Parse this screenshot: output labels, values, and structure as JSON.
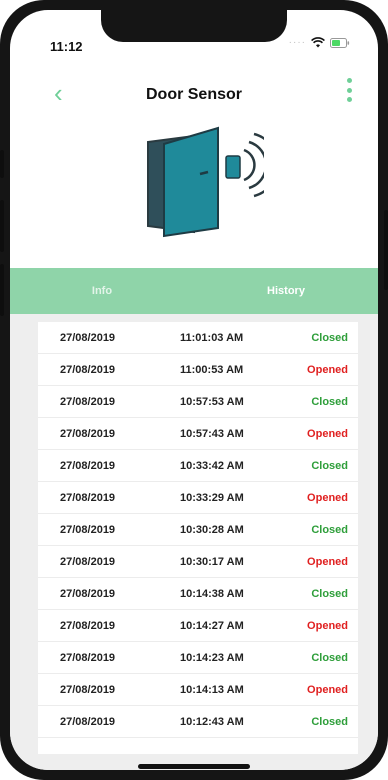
{
  "status_bar": {
    "time": "11:12"
  },
  "header": {
    "title": "Door Sensor"
  },
  "tabs": [
    {
      "label": "Info",
      "active": false
    },
    {
      "label": "History",
      "active": true
    }
  ],
  "colors": {
    "accent": "#6fcf98",
    "tab_bar": "#8fd4a9",
    "closed": "#2e9e3a",
    "opened": "#e02020"
  },
  "history": [
    {
      "date": "27/08/2019",
      "time": "11:01:03 AM",
      "status": "Closed"
    },
    {
      "date": "27/08/2019",
      "time": "11:00:53 AM",
      "status": "Opened"
    },
    {
      "date": "27/08/2019",
      "time": "10:57:53 AM",
      "status": "Closed"
    },
    {
      "date": "27/08/2019",
      "time": "10:57:43 AM",
      "status": "Opened"
    },
    {
      "date": "27/08/2019",
      "time": "10:33:42 AM",
      "status": "Closed"
    },
    {
      "date": "27/08/2019",
      "time": "10:33:29 AM",
      "status": "Opened"
    },
    {
      "date": "27/08/2019",
      "time": "10:30:28 AM",
      "status": "Closed"
    },
    {
      "date": "27/08/2019",
      "time": "10:30:17 AM",
      "status": "Opened"
    },
    {
      "date": "27/08/2019",
      "time": "10:14:38 AM",
      "status": "Closed"
    },
    {
      "date": "27/08/2019",
      "time": "10:14:27 AM",
      "status": "Opened"
    },
    {
      "date": "27/08/2019",
      "time": "10:14:23 AM",
      "status": "Closed"
    },
    {
      "date": "27/08/2019",
      "time": "10:14:13 AM",
      "status": "Opened"
    },
    {
      "date": "27/08/2019",
      "time": "10:12:43 AM",
      "status": "Closed"
    }
  ]
}
